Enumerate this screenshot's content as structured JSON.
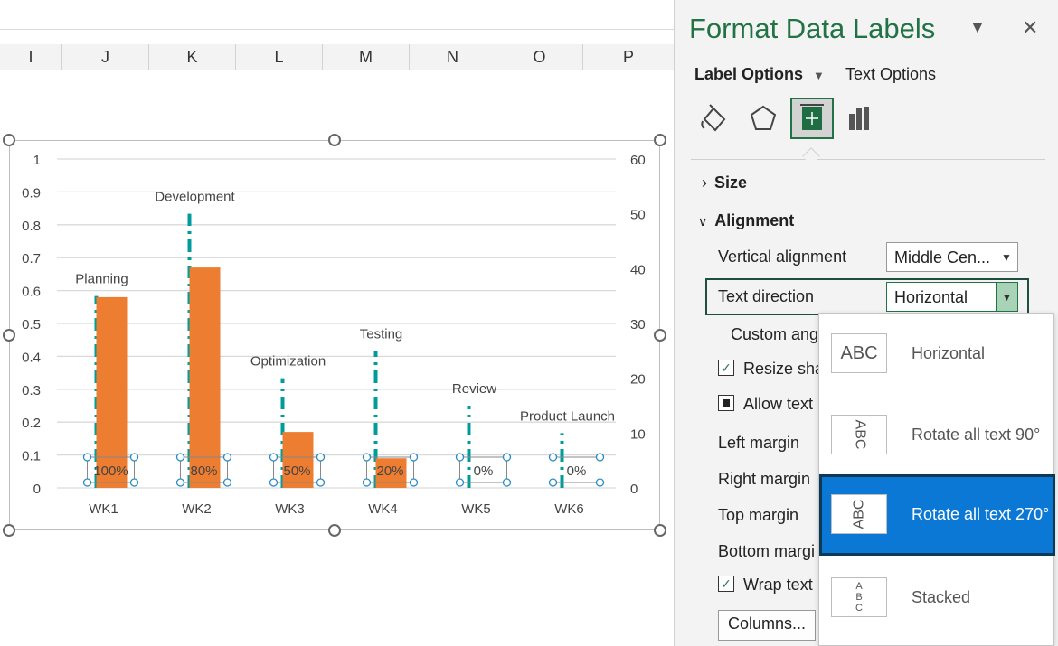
{
  "sheet": {
    "columns": [
      "I",
      "J",
      "K",
      "L",
      "M",
      "N",
      "O",
      "P"
    ]
  },
  "chart_data": {
    "type": "bar",
    "categories": [
      "WK1",
      "WK2",
      "WK3",
      "WK4",
      "WK5",
      "WK6"
    ],
    "series": [
      {
        "values": [
          0.58,
          0.67,
          0.17,
          0.09,
          0.0,
          0.0
        ],
        "color": "#ed7d31"
      },
      {
        "values": [
          35,
          50,
          20,
          25,
          15,
          10
        ],
        "color": "#009b9b",
        "axis": "secondary",
        "style": "dash-dot"
      }
    ],
    "data_labels": [
      "100%",
      "80%",
      "50%",
      "20%",
      "0%",
      "0%"
    ],
    "annotations": [
      "Planning",
      "Development",
      "Optimization",
      "Testing",
      "Review",
      "Product Launch"
    ],
    "y_ticks": [
      "1",
      "0.9",
      "0.8",
      "0.7",
      "0.6",
      "0.5",
      "0.4",
      "0.3",
      "0.2",
      "0.1",
      "0"
    ],
    "y2_ticks": [
      "60",
      "50",
      "40",
      "30",
      "20",
      "10",
      "0"
    ],
    "ylim": [
      0,
      1
    ],
    "y2lim": [
      0,
      60
    ],
    "grid": true
  },
  "pane": {
    "title": "Format Data Labels",
    "tabs": {
      "label_options": "Label Options",
      "text_options": "Text Options"
    },
    "icons": [
      "fill-line-icon",
      "effects-icon",
      "size-properties-icon",
      "label-options-icon"
    ],
    "sections": {
      "size": "Size",
      "alignment": "Alignment"
    },
    "vertical_alignment": {
      "label": "Vertical alignment",
      "value": "Middle Cen..."
    },
    "text_direction": {
      "label": "Text direction",
      "value": "Horizontal"
    },
    "custom_angle": "Custom ang",
    "resize_shape": "Resize shap",
    "allow_text": "Allow text",
    "left_margin": "Left margin",
    "right_margin": "Right margin",
    "top_margin": "Top margin",
    "bottom_margin": "Bottom margi",
    "wrap_text": "Wrap text",
    "columns_button": "Columns..."
  },
  "direction_options": [
    {
      "label": "Horizontal",
      "thumb": "ABC"
    },
    {
      "label": "Rotate all text 90°",
      "thumb": "ABC"
    },
    {
      "label": "Rotate all text 270°",
      "thumb": "ABC"
    },
    {
      "label": "Stacked",
      "thumb": "ABC"
    }
  ]
}
